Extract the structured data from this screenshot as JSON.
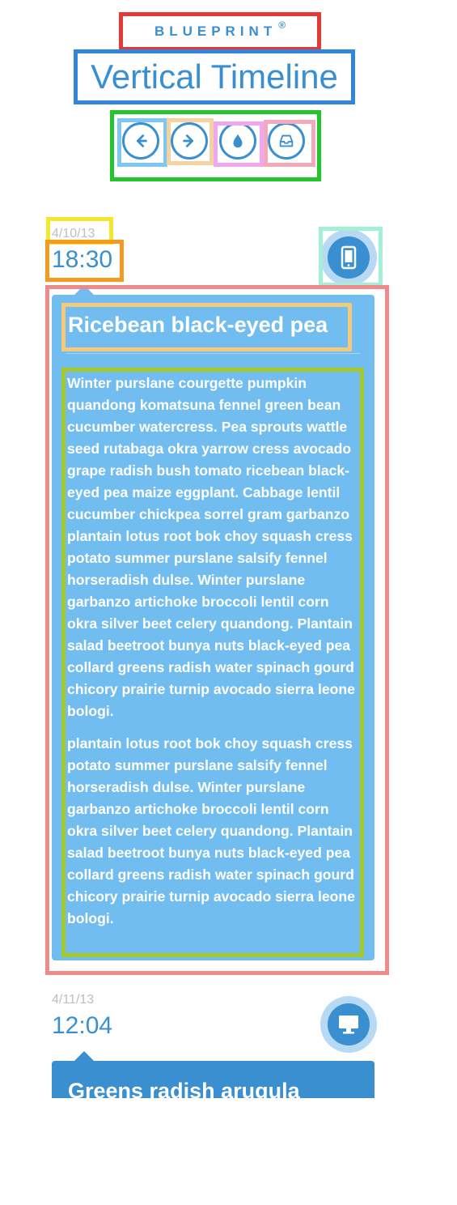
{
  "header": {
    "brand": "BLUEPRINT",
    "brand_mark": "®",
    "title": "Vertical Timeline"
  },
  "toolbar": {
    "buttons": [
      {
        "name": "previous",
        "icon": "arrow-left-icon"
      },
      {
        "name": "next",
        "icon": "arrow-right-icon"
      },
      {
        "name": "color",
        "icon": "droplet-icon"
      },
      {
        "name": "inbox",
        "icon": "inbox-icon"
      }
    ]
  },
  "entries": [
    {
      "date": "4/10/13",
      "time": "18:30",
      "icon": "mobile-phone-icon",
      "title": "Ricebean black-eyed pea",
      "paragraphs": [
        "Winter purslane courgette pumpkin quandong komatsuna fennel green bean cucumber watercress. Pea sprouts wattle seed rutabaga okra yarrow cress avocado grape radish bush tomato ricebean black-eyed pea maize eggplant. Cabbage lentil cucumber chickpea sorrel gram garbanzo plantain lotus root bok choy squash cress potato summer purslane salsify fennel horseradish dulse. Winter purslane garbanzo artichoke broccoli lentil corn okra silver beet celery quandong. Plantain salad beetroot bunya nuts black-eyed pea collard greens radish water spinach gourd chicory prairie turnip avocado sierra leone bologi.",
        "plantain lotus root bok choy squash cress potato summer purslane salsify fennel horseradish dulse. Winter purslane garbanzo artichoke broccoli lentil corn okra silver beet celery quandong. Plantain salad beetroot bunya nuts black-eyed pea collard greens radish water spinach gourd chicory prairie turnip avocado sierra leone bologi."
      ]
    },
    {
      "date": "4/11/13",
      "time": "12:04",
      "icon": "desktop-monitor-icon",
      "title": "Greens radish arugula"
    }
  ],
  "colors": {
    "accent": "#3a8fd0",
    "card": "#72bdf0",
    "icon_ring": "#b7d9f3",
    "date_gray": "#b9c0c7"
  },
  "annotation_colors": {
    "brand": "#e53935",
    "title": "#2f86dc",
    "toolbar": "#22c62a",
    "btn_prev": "#7ec7f2",
    "btn_next": "#f5d3a0",
    "btn_color": "#f0a6f0",
    "btn_inbox": "#f2a9b9",
    "date": "#f5e72f",
    "time": "#f39a1f",
    "event_icon": "#a3f0d6",
    "card": "#ee8a8a",
    "card_title": "#f5c97a",
    "card_body": "#a6c92a"
  }
}
